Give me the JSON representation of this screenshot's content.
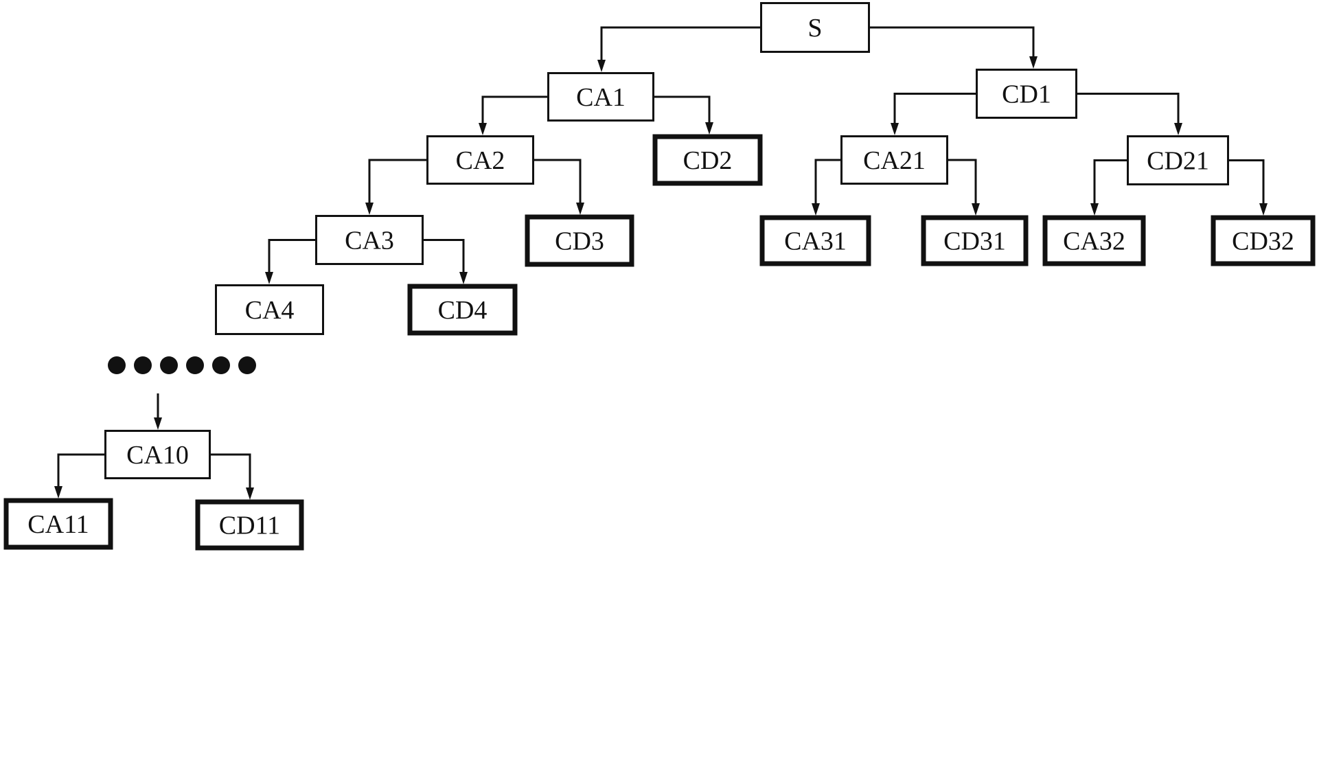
{
  "diagram": {
    "type": "tree",
    "colors": {
      "stroke": "#111111",
      "background": "#ffffff"
    },
    "nodes": [
      {
        "id": "S",
        "label": "S",
        "kind": "normal"
      },
      {
        "id": "CA1",
        "label": "CA1",
        "kind": "normal"
      },
      {
        "id": "CD1",
        "label": "CD1",
        "kind": "normal"
      },
      {
        "id": "CA2",
        "label": "CA2",
        "kind": "normal"
      },
      {
        "id": "CD2",
        "label": "CD2",
        "kind": "leaf"
      },
      {
        "id": "CA21",
        "label": "CA21",
        "kind": "normal"
      },
      {
        "id": "CD21",
        "label": "CD21",
        "kind": "normal"
      },
      {
        "id": "CA3",
        "label": "CA3",
        "kind": "normal"
      },
      {
        "id": "CD3",
        "label": "CD3",
        "kind": "leaf"
      },
      {
        "id": "CA31",
        "label": "CA31",
        "kind": "leaf"
      },
      {
        "id": "CD31",
        "label": "CD31",
        "kind": "leaf"
      },
      {
        "id": "CA32",
        "label": "CA32",
        "kind": "leaf"
      },
      {
        "id": "CD32",
        "label": "CD32",
        "kind": "leaf"
      },
      {
        "id": "CA4",
        "label": "CA4",
        "kind": "normal"
      },
      {
        "id": "CD4",
        "label": "CD4",
        "kind": "leaf"
      },
      {
        "id": "CA10",
        "label": "CA10",
        "kind": "normal"
      },
      {
        "id": "CA11",
        "label": "CA11",
        "kind": "leaf"
      },
      {
        "id": "CD11",
        "label": "CD11",
        "kind": "leaf"
      }
    ],
    "edges": [
      {
        "from": "S",
        "to": "CA1"
      },
      {
        "from": "S",
        "to": "CD1"
      },
      {
        "from": "CA1",
        "to": "CA2"
      },
      {
        "from": "CA1",
        "to": "CD2"
      },
      {
        "from": "CD1",
        "to": "CA21"
      },
      {
        "from": "CD1",
        "to": "CD21"
      },
      {
        "from": "CA2",
        "to": "CA3"
      },
      {
        "from": "CA2",
        "to": "CD3"
      },
      {
        "from": "CA21",
        "to": "CA31"
      },
      {
        "from": "CA21",
        "to": "CD31"
      },
      {
        "from": "CD21",
        "to": "CA32"
      },
      {
        "from": "CD21",
        "to": "CD32"
      },
      {
        "from": "CA3",
        "to": "CA4"
      },
      {
        "from": "CA3",
        "to": "CD4"
      },
      {
        "from": "CA10",
        "to": "CA11"
      },
      {
        "from": "CA10",
        "to": "CD11"
      }
    ],
    "ellipsis": {
      "dot_count": 6,
      "between": [
        "CA4",
        "CA10"
      ]
    }
  }
}
